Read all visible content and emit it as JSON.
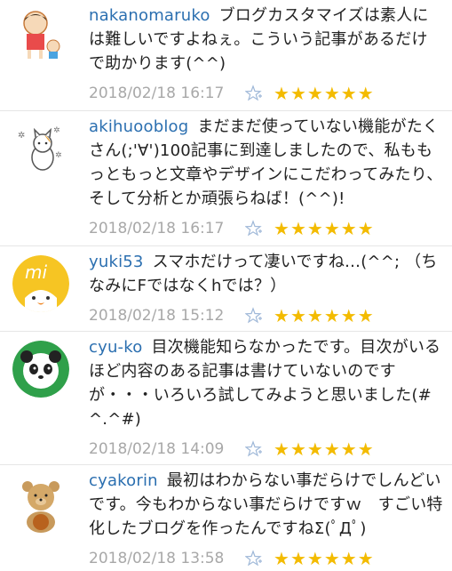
{
  "colors": {
    "username": "#2b6fb0",
    "date": "#a8a8a8",
    "star": "#f3bb00"
  },
  "comments": [
    {
      "username": "nakanomaruko",
      "text": "ブログカスタマイズは素人には難しいですよねぇ。こういう記事があるだけで助かります(^^)",
      "date": "2018/02/18 16:17",
      "stars": 6
    },
    {
      "username": "akihuooblog",
      "text": "まだまだ使っていない機能がたくさん(;'∀')100記事に到達しましたので、私ももっともっと文章やデザインにこだわってみたり、そして分析とか頑張らねば！(^^)!",
      "date": "2018/02/18 16:17",
      "stars": 6
    },
    {
      "username": "yuki53",
      "text": "スマホだけって凄いですね…(^^; （ちなみにFではなくhでは？）",
      "date": "2018/02/18 15:12",
      "stars": 6
    },
    {
      "username": "cyu-ko",
      "text": "目次機能知らなかったです。目次がいるほど内容のある記事は書けていないのですが・・・いろいろ試してみようと思いました(#^.^#)",
      "date": "2018/02/18 14:09",
      "stars": 6
    },
    {
      "username": "cyakorin",
      "text": "最初はわからない事だらけでしんどいです。今もわからない事だらけですｗ　すごい特化したブログを作ったんですねΣ(ﾟДﾟ)",
      "date": "2018/02/18 13:58",
      "stars": 6
    }
  ],
  "add_star_icon": "add-star-icon",
  "star_icon": "star-icon",
  "star_glyph": "★"
}
